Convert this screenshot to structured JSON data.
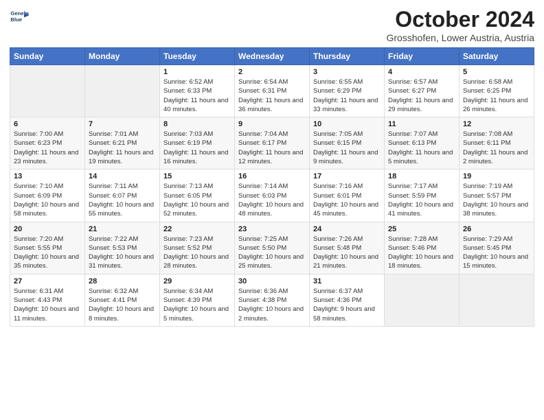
{
  "header": {
    "logo_line1": "General",
    "logo_line2": "Blue",
    "month": "October 2024",
    "location": "Grosshofen, Lower Austria, Austria"
  },
  "days_of_week": [
    "Sunday",
    "Monday",
    "Tuesday",
    "Wednesday",
    "Thursday",
    "Friday",
    "Saturday"
  ],
  "weeks": [
    [
      {
        "date": "",
        "info": ""
      },
      {
        "date": "",
        "info": ""
      },
      {
        "date": "1",
        "info": "Sunrise: 6:52 AM\nSunset: 6:33 PM\nDaylight: 11 hours and 40 minutes."
      },
      {
        "date": "2",
        "info": "Sunrise: 6:54 AM\nSunset: 6:31 PM\nDaylight: 11 hours and 36 minutes."
      },
      {
        "date": "3",
        "info": "Sunrise: 6:55 AM\nSunset: 6:29 PM\nDaylight: 11 hours and 33 minutes."
      },
      {
        "date": "4",
        "info": "Sunrise: 6:57 AM\nSunset: 6:27 PM\nDaylight: 11 hours and 29 minutes."
      },
      {
        "date": "5",
        "info": "Sunrise: 6:58 AM\nSunset: 6:25 PM\nDaylight: 11 hours and 26 minutes."
      }
    ],
    [
      {
        "date": "6",
        "info": "Sunrise: 7:00 AM\nSunset: 6:23 PM\nDaylight: 11 hours and 23 minutes."
      },
      {
        "date": "7",
        "info": "Sunrise: 7:01 AM\nSunset: 6:21 PM\nDaylight: 11 hours and 19 minutes."
      },
      {
        "date": "8",
        "info": "Sunrise: 7:03 AM\nSunset: 6:19 PM\nDaylight: 11 hours and 16 minutes."
      },
      {
        "date": "9",
        "info": "Sunrise: 7:04 AM\nSunset: 6:17 PM\nDaylight: 11 hours and 12 minutes."
      },
      {
        "date": "10",
        "info": "Sunrise: 7:05 AM\nSunset: 6:15 PM\nDaylight: 11 hours and 9 minutes."
      },
      {
        "date": "11",
        "info": "Sunrise: 7:07 AM\nSunset: 6:13 PM\nDaylight: 11 hours and 5 minutes."
      },
      {
        "date": "12",
        "info": "Sunrise: 7:08 AM\nSunset: 6:11 PM\nDaylight: 11 hours and 2 minutes."
      }
    ],
    [
      {
        "date": "13",
        "info": "Sunrise: 7:10 AM\nSunset: 6:09 PM\nDaylight: 10 hours and 58 minutes."
      },
      {
        "date": "14",
        "info": "Sunrise: 7:11 AM\nSunset: 6:07 PM\nDaylight: 10 hours and 55 minutes."
      },
      {
        "date": "15",
        "info": "Sunrise: 7:13 AM\nSunset: 6:05 PM\nDaylight: 10 hours and 52 minutes."
      },
      {
        "date": "16",
        "info": "Sunrise: 7:14 AM\nSunset: 6:03 PM\nDaylight: 10 hours and 48 minutes."
      },
      {
        "date": "17",
        "info": "Sunrise: 7:16 AM\nSunset: 6:01 PM\nDaylight: 10 hours and 45 minutes."
      },
      {
        "date": "18",
        "info": "Sunrise: 7:17 AM\nSunset: 5:59 PM\nDaylight: 10 hours and 41 minutes."
      },
      {
        "date": "19",
        "info": "Sunrise: 7:19 AM\nSunset: 5:57 PM\nDaylight: 10 hours and 38 minutes."
      }
    ],
    [
      {
        "date": "20",
        "info": "Sunrise: 7:20 AM\nSunset: 5:55 PM\nDaylight: 10 hours and 35 minutes."
      },
      {
        "date": "21",
        "info": "Sunrise: 7:22 AM\nSunset: 5:53 PM\nDaylight: 10 hours and 31 minutes."
      },
      {
        "date": "22",
        "info": "Sunrise: 7:23 AM\nSunset: 5:52 PM\nDaylight: 10 hours and 28 minutes."
      },
      {
        "date": "23",
        "info": "Sunrise: 7:25 AM\nSunset: 5:50 PM\nDaylight: 10 hours and 25 minutes."
      },
      {
        "date": "24",
        "info": "Sunrise: 7:26 AM\nSunset: 5:48 PM\nDaylight: 10 hours and 21 minutes."
      },
      {
        "date": "25",
        "info": "Sunrise: 7:28 AM\nSunset: 5:46 PM\nDaylight: 10 hours and 18 minutes."
      },
      {
        "date": "26",
        "info": "Sunrise: 7:29 AM\nSunset: 5:45 PM\nDaylight: 10 hours and 15 minutes."
      }
    ],
    [
      {
        "date": "27",
        "info": "Sunrise: 6:31 AM\nSunset: 4:43 PM\nDaylight: 10 hours and 11 minutes."
      },
      {
        "date": "28",
        "info": "Sunrise: 6:32 AM\nSunset: 4:41 PM\nDaylight: 10 hours and 8 minutes."
      },
      {
        "date": "29",
        "info": "Sunrise: 6:34 AM\nSunset: 4:39 PM\nDaylight: 10 hours and 5 minutes."
      },
      {
        "date": "30",
        "info": "Sunrise: 6:36 AM\nSunset: 4:38 PM\nDaylight: 10 hours and 2 minutes."
      },
      {
        "date": "31",
        "info": "Sunrise: 6:37 AM\nSunset: 4:36 PM\nDaylight: 9 hours and 58 minutes."
      },
      {
        "date": "",
        "info": ""
      },
      {
        "date": "",
        "info": ""
      }
    ]
  ]
}
